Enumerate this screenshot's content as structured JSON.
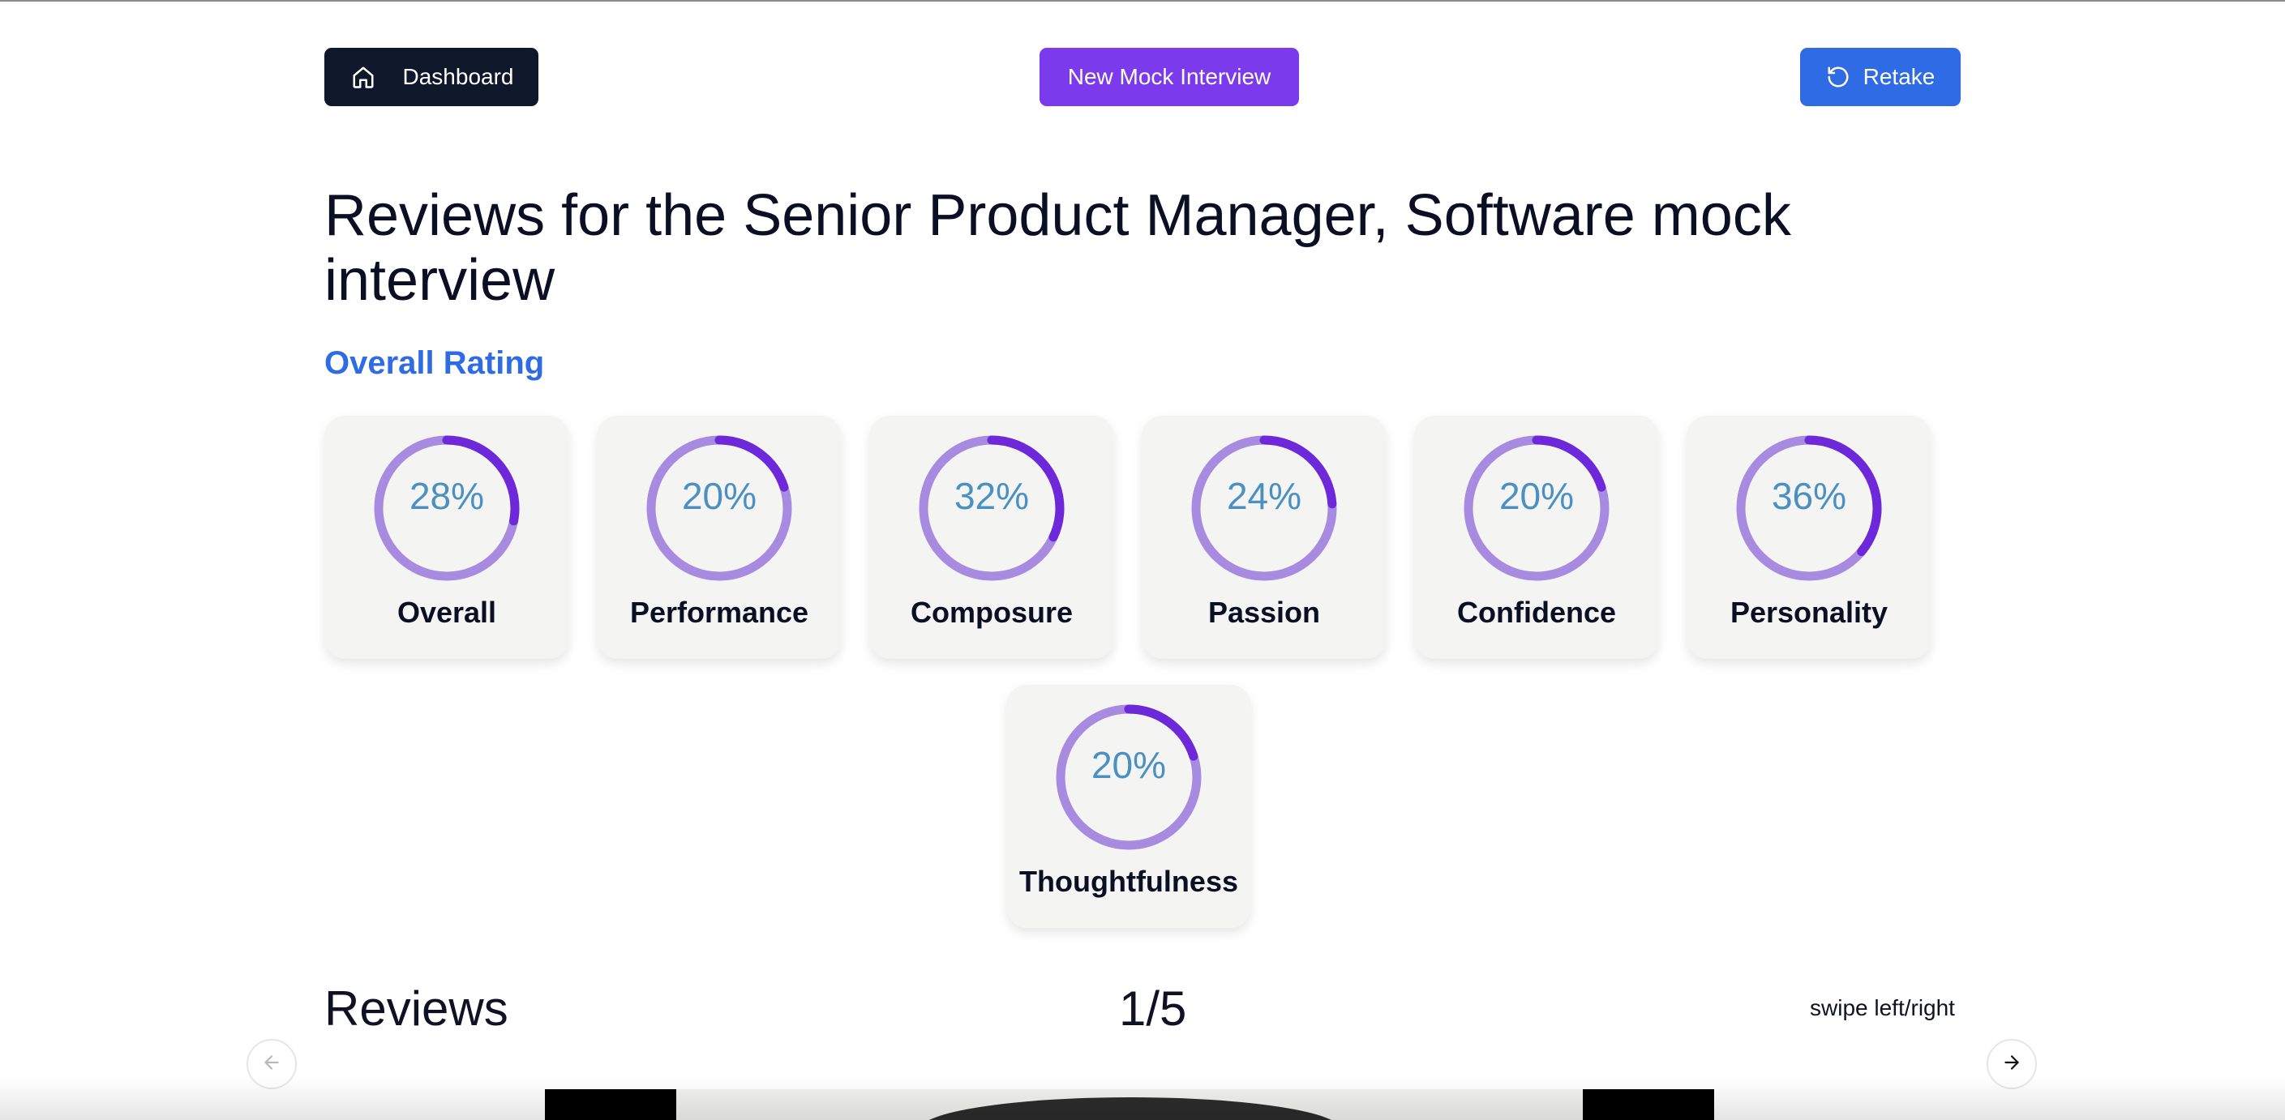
{
  "toolbar": {
    "dashboard_label": "Dashboard",
    "new_interview_label": "New Mock Interview",
    "retake_label": "Retake"
  },
  "page": {
    "title": "Reviews for the Senior Product Manager, Software mock interview",
    "overall_rating_label": "Overall Rating"
  },
  "ratings": [
    {
      "label": "Overall",
      "percent_text": "28%",
      "value": 28
    },
    {
      "label": "Performance",
      "percent_text": "20%",
      "value": 20
    },
    {
      "label": "Composure",
      "percent_text": "32%",
      "value": 32
    },
    {
      "label": "Passion",
      "percent_text": "24%",
      "value": 24
    },
    {
      "label": "Confidence",
      "percent_text": "20%",
      "value": 20
    },
    {
      "label": "Personality",
      "percent_text": "36%",
      "value": 36
    },
    {
      "label": "Thoughtfulness",
      "percent_text": "20%",
      "value": 20
    }
  ],
  "reviews": {
    "title": "Reviews",
    "counter": "1/5",
    "hint": "swipe left/right"
  },
  "colors": {
    "ring_track": "#a78be0",
    "ring_progress": "#6d28d9",
    "percent_text": "#4a90c0",
    "accent_blue": "#2f6be5",
    "accent_purple": "#7c3aed"
  },
  "icons": {
    "dashboard": "home-icon",
    "retake": "rotate-ccw-icon",
    "prev": "arrow-left-icon",
    "next": "arrow-right-icon"
  }
}
